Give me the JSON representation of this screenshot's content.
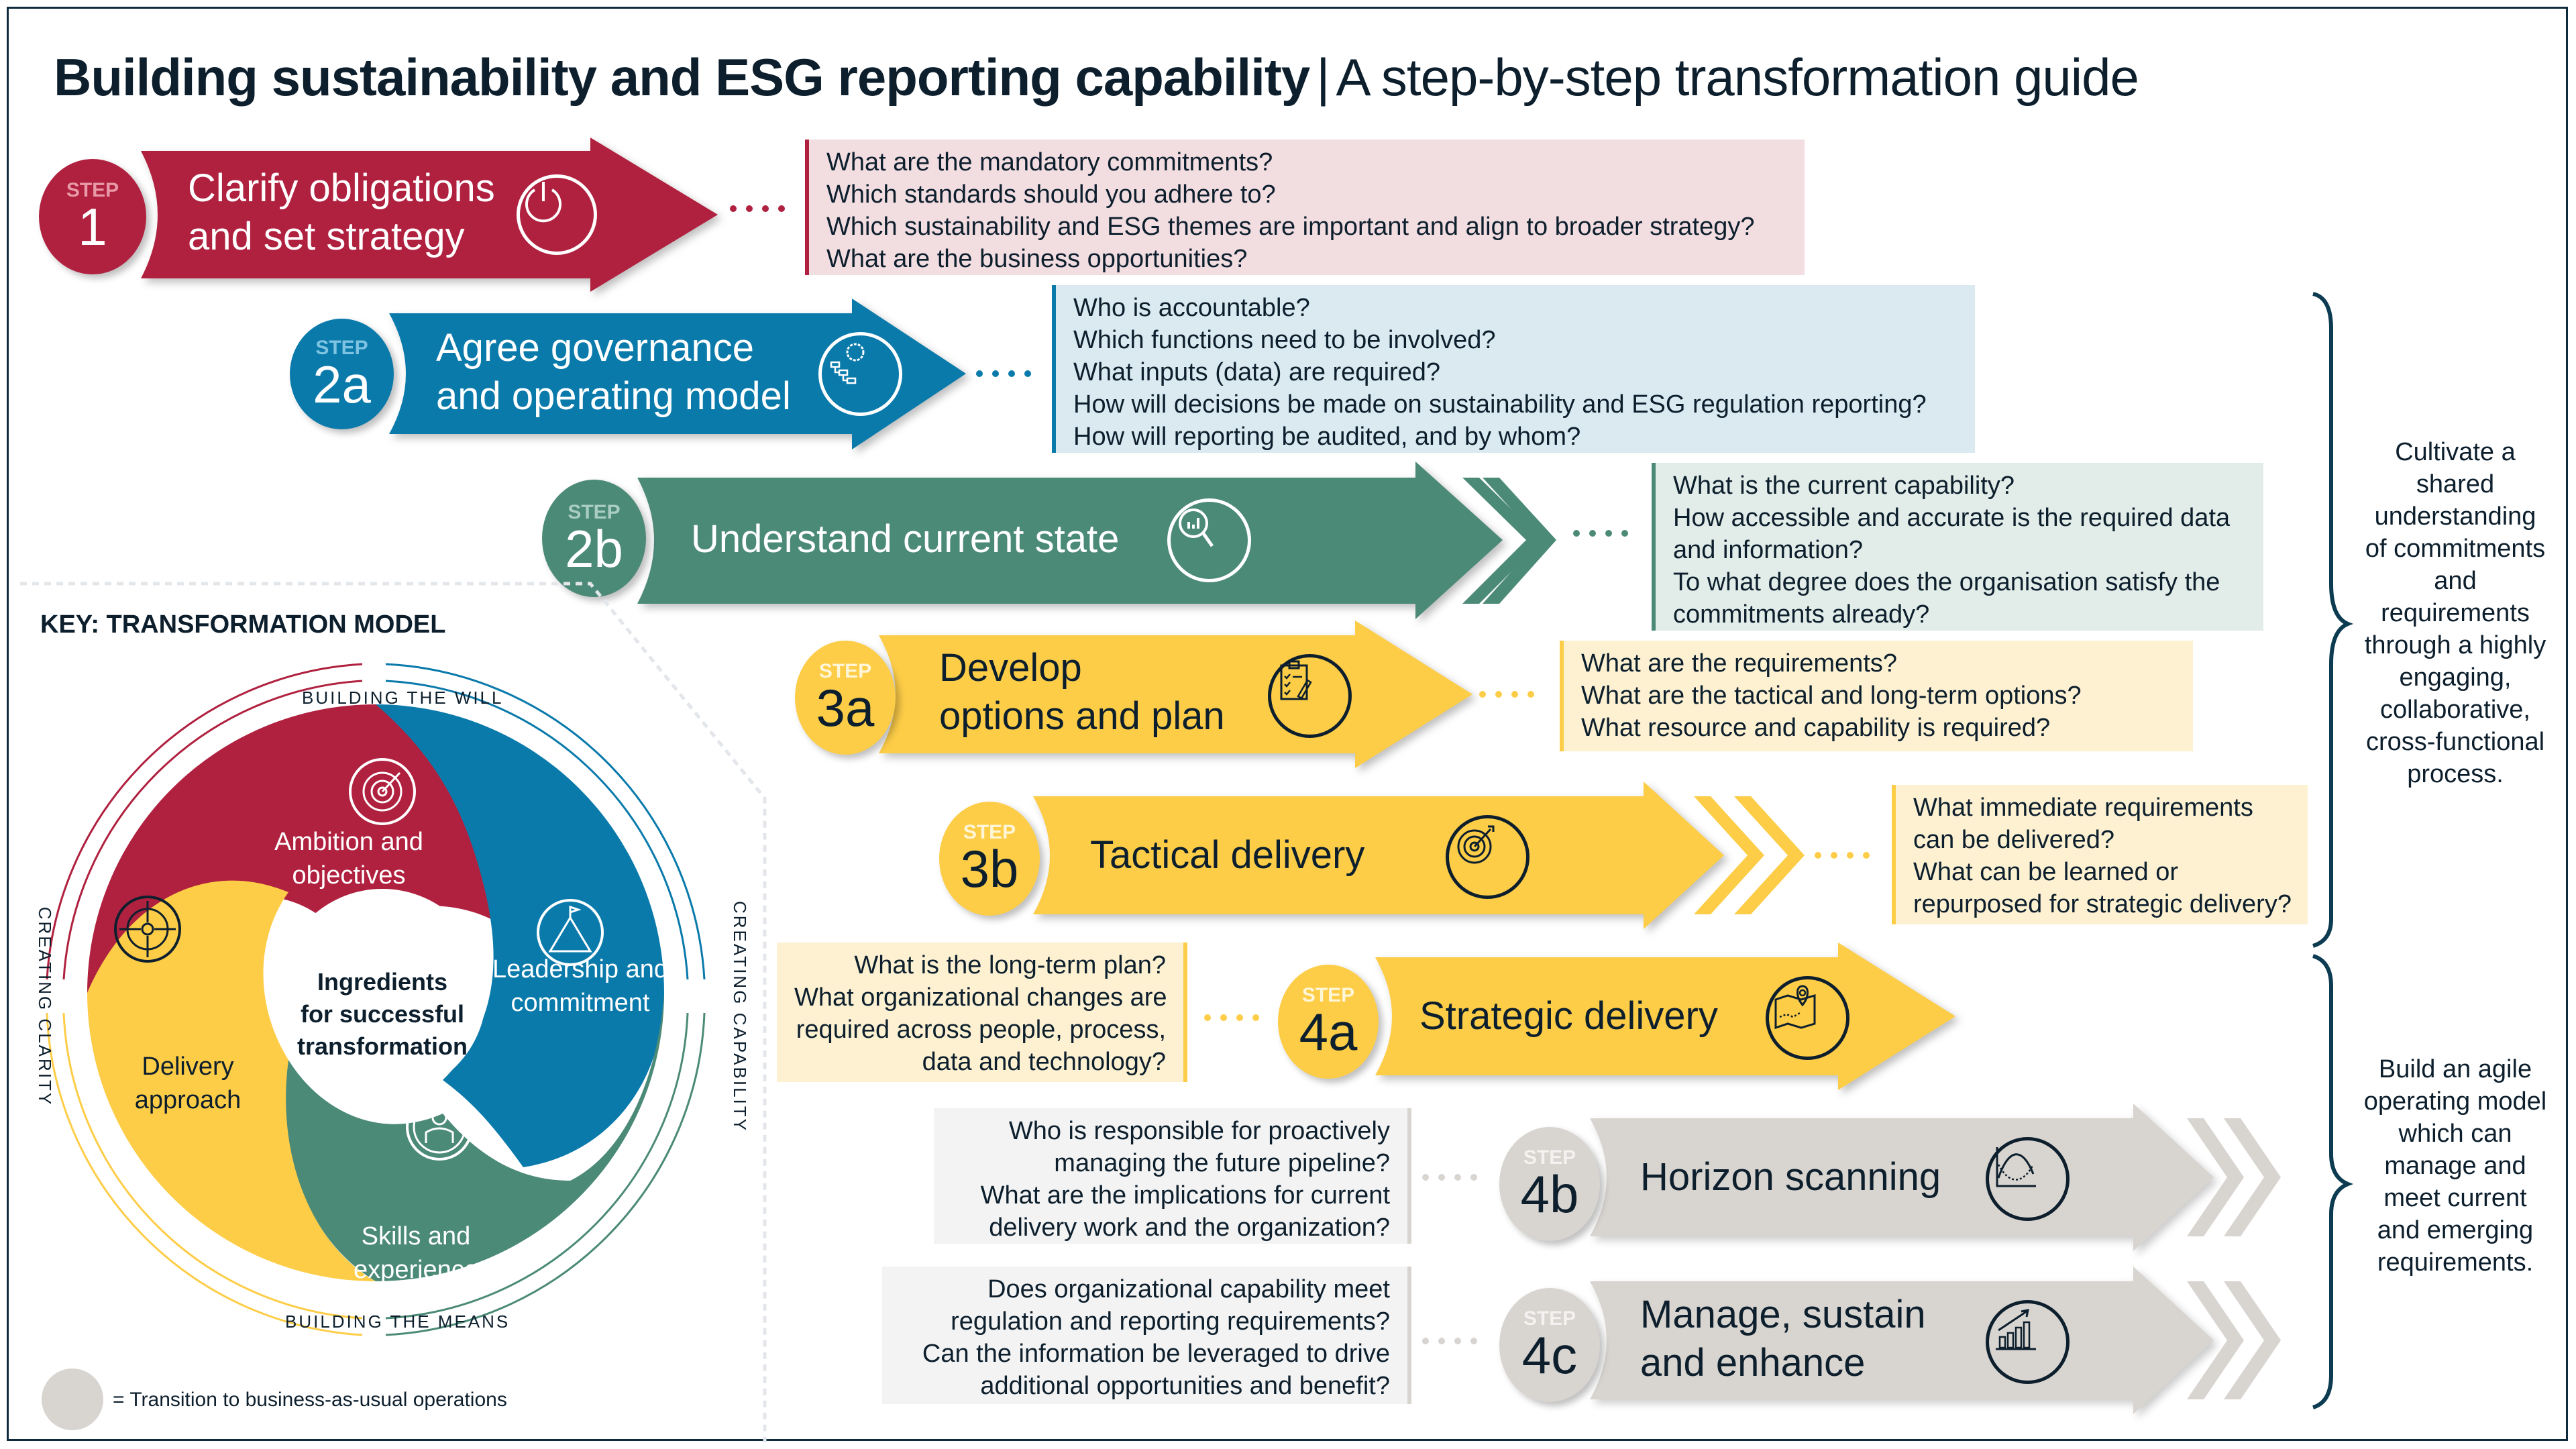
{
  "title": {
    "main": "Building sustainability and ESG reporting capability",
    "separator": "|",
    "subtitle": "A step-by-step transformation guide"
  },
  "colors": {
    "step1": "#b0213f",
    "step2a": "#0a7aab",
    "step2b": "#4c8a78",
    "step3": "#fdcd48",
    "step4bau": "#d8d4d0",
    "q1_bg": "#f2dde1",
    "q2a_bg": "#dbeaf1",
    "q2b_bg": "#e2ece8",
    "q3_bg": "#fdf1d2",
    "q4_bg": "#f3f3f3",
    "brace": "#0d3b52",
    "text_dark": "#0d1f2d"
  },
  "steps": [
    {
      "id": "1",
      "word": "STEP",
      "number": "1",
      "label_lines": [
        "Clarify obligations",
        "and set strategy"
      ],
      "icon": "power-icon",
      "questions": [
        "What are the mandatory commitments?",
        "Which standards should you adhere to?",
        "Which sustainability and ESG themes are important and align to broader strategy?",
        "What are the business opportunities?"
      ]
    },
    {
      "id": "2a",
      "word": "STEP",
      "number": "2a",
      "label_lines": [
        "Agree governance",
        "and operating model"
      ],
      "icon": "gear-org-chart-icon",
      "questions": [
        "Who is accountable?",
        "Which functions need to be involved?",
        "What inputs (data) are required?",
        "How will decisions be made on sustainability and ESG regulation reporting?",
        "How will reporting be audited, and by whom?"
      ]
    },
    {
      "id": "2b",
      "word": "STEP",
      "number": "2b",
      "label_lines": [
        "Understand current state"
      ],
      "icon": "magnifier-chart-icon",
      "questions": [
        "What is the current capability?",
        "How accessible and accurate is the required data",
        "and information?",
        "To what degree does the organisation satisfy the",
        "commitments already?"
      ]
    },
    {
      "id": "3a",
      "word": "STEP",
      "number": "3a",
      "label_lines": [
        "Develop",
        "options and plan"
      ],
      "icon": "clipboard-checklist-icon",
      "questions": [
        "What are the requirements?",
        "What are the tactical and long-term options?",
        "What resource and capability is required?"
      ]
    },
    {
      "id": "3b",
      "word": "STEP",
      "number": "3b",
      "label_lines": [
        "Tactical delivery"
      ],
      "icon": "target-arrow-icon",
      "questions": [
        "What immediate requirements",
        "can be delivered?",
        "What can be learned or",
        "repurposed for strategic delivery?"
      ]
    },
    {
      "id": "4a",
      "word": "STEP",
      "number": "4a",
      "label_lines": [
        "Strategic delivery"
      ],
      "icon": "map-pin-icon",
      "questions": [
        "What is the long-term plan?",
        "What organizational changes are",
        "required across people, process,",
        "data and technology?"
      ]
    },
    {
      "id": "4b",
      "word": "STEP",
      "number": "4b",
      "label_lines": [
        "Horizon scanning"
      ],
      "icon": "trend-graph-icon",
      "questions": [
        "Who is responsible for proactively",
        "managing the future pipeline?",
        "What are the implications for current",
        "delivery work and the organization?"
      ]
    },
    {
      "id": "4c",
      "word": "STEP",
      "number": "4c",
      "label_lines": [
        "Manage, sustain",
        "and enhance"
      ],
      "icon": "growth-bars-icon",
      "questions": [
        "Does organizational capability meet",
        "regulation and reporting requirements?",
        "Can the information be leveraged to drive",
        "additional opportunities and benefit?"
      ]
    }
  ],
  "braces": [
    {
      "text_lines": [
        "Cultivate a",
        "shared",
        "understanding",
        "of commitments",
        "and",
        "requirements",
        "through a highly",
        "engaging,",
        "collaborative,",
        "cross-functional",
        "process."
      ]
    },
    {
      "text_lines": [
        "Build an agile",
        "operating model",
        "which can",
        "manage and",
        "meet current",
        "and emerging",
        "requirements."
      ]
    }
  ],
  "key": {
    "title": "KEY: TRANSFORMATION MODEL",
    "center_lines": [
      "Ingredients",
      "for successful",
      "transformation"
    ],
    "segments": [
      {
        "name": "ambition",
        "lines": [
          "Ambition and",
          "objectives"
        ],
        "icon": "target-arrow-icon",
        "color": "#b0213f"
      },
      {
        "name": "leadership",
        "lines": [
          "Leadership and",
          "commitment"
        ],
        "icon": "mountain-flag-icon",
        "color": "#0a7aab"
      },
      {
        "name": "skills",
        "lines": [
          "Skills and",
          "experience"
        ],
        "icon": "person-network-icon",
        "color": "#4c8a78"
      },
      {
        "name": "delivery",
        "lines": [
          "Delivery",
          "approach"
        ],
        "icon": "crosshair-target-icon",
        "color": "#fdcd48"
      }
    ],
    "arc_labels": {
      "top": "BUILDING THE WILL",
      "bottom": "BUILDING THE MEANS",
      "left": "CREATING CLARITY",
      "right": "CREATING CAPABILITY"
    },
    "legend_text": "= Transition to business-as-usual operations"
  }
}
